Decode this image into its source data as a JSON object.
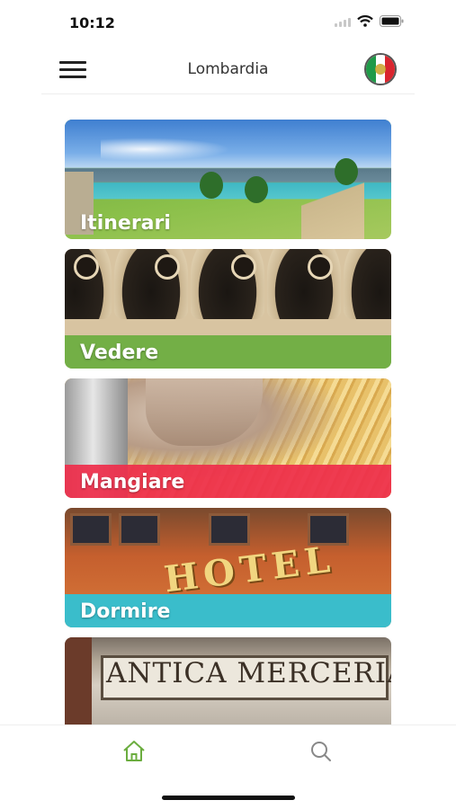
{
  "status_bar": {
    "time": "10:12"
  },
  "header": {
    "title": "Lombardia"
  },
  "categories": [
    {
      "label": "Itinerari",
      "band_color": "#7cb342"
    },
    {
      "label": "Vedere",
      "band_color": "#6bad3f"
    },
    {
      "label": "Mangiare",
      "band_color": "#ee2e4b"
    },
    {
      "label": "Dormire",
      "band_color": "#2ec3d6"
    }
  ],
  "shop_sign": "ANTICA MERCERIA",
  "colors": {
    "accent": "#6bad3f",
    "hotel_sign": "HOTEL"
  },
  "tab_bar": [
    {
      "icon": "home-icon",
      "active": true
    },
    {
      "icon": "search-icon",
      "active": false
    }
  ]
}
